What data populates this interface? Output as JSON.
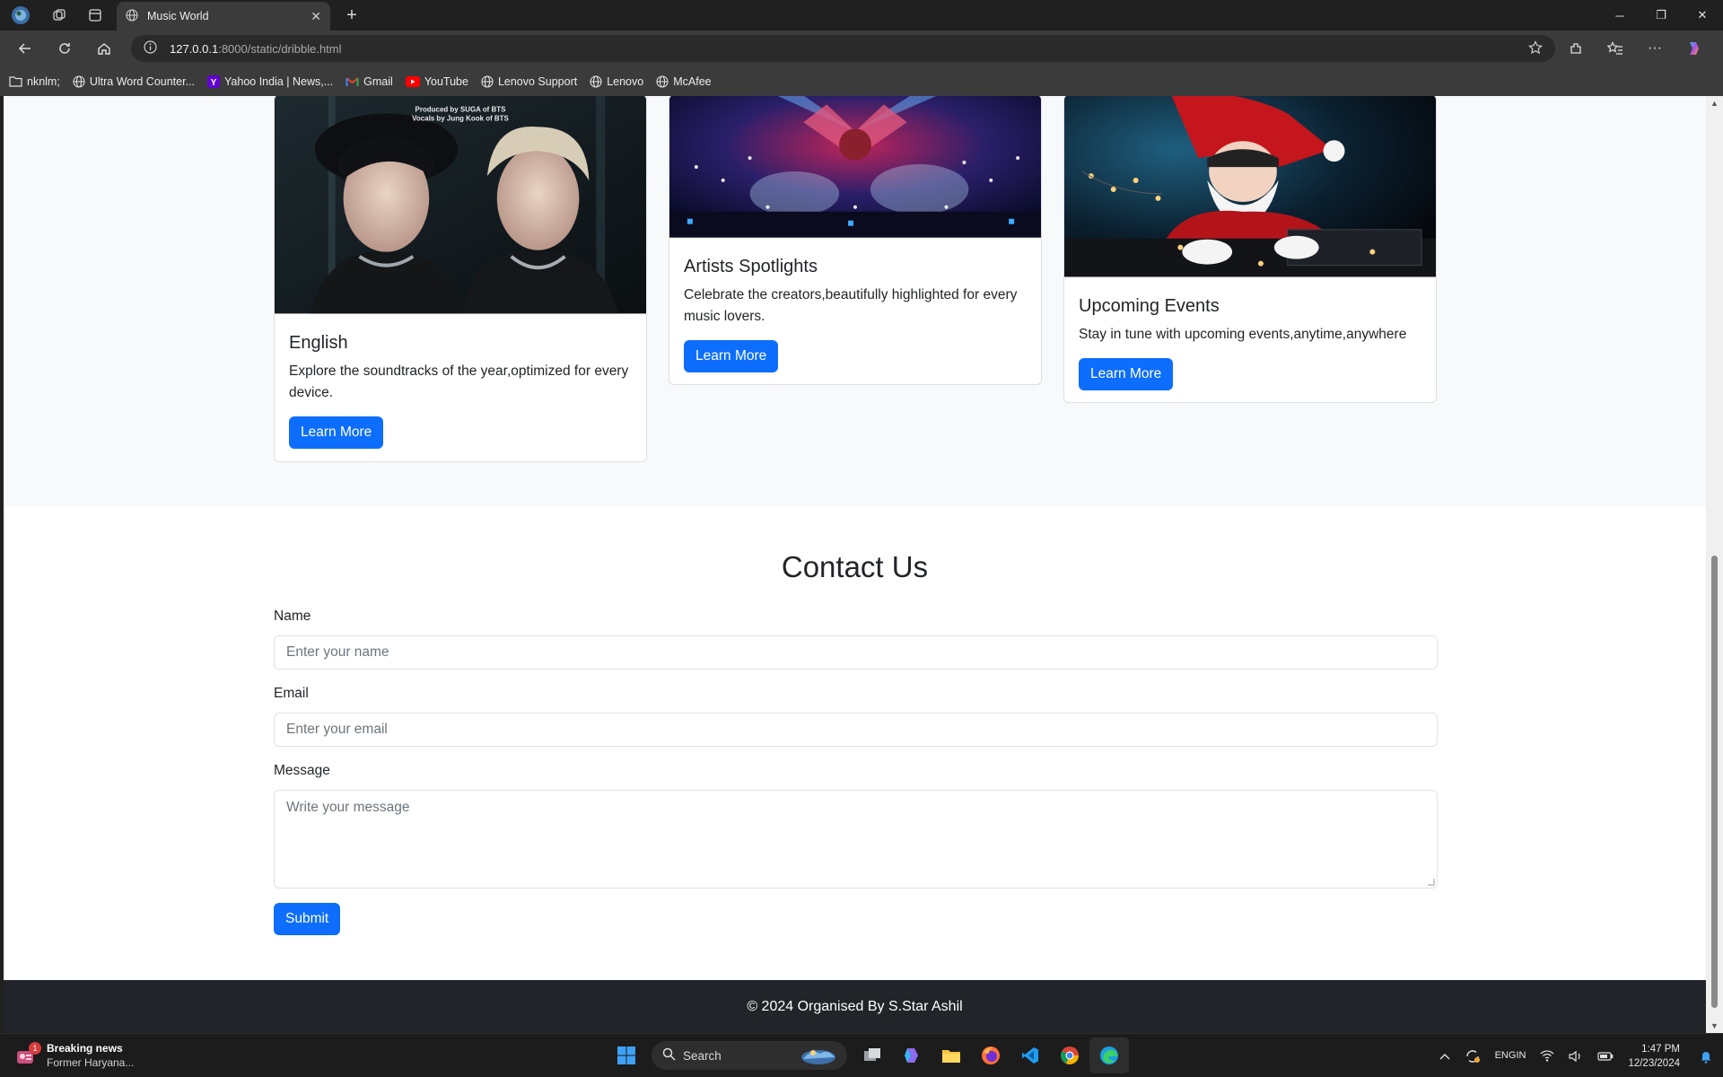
{
  "browser": {
    "tab_title": "Music World",
    "url_host": "127.0.0.1",
    "url_rest": ":8000/static/dribble.html",
    "bookmarks": [
      {
        "label": "nknlm;",
        "icon": "folder-icon"
      },
      {
        "label": "Ultra Word Counter...",
        "icon": "globe-icon"
      },
      {
        "label": "Yahoo India | News,...",
        "icon": "yahoo-icon"
      },
      {
        "label": "Gmail",
        "icon": "gmail-icon"
      },
      {
        "label": "YouTube",
        "icon": "youtube-icon"
      },
      {
        "label": "Lenovo Support",
        "icon": "globe-icon"
      },
      {
        "label": "Lenovo",
        "icon": "globe-icon"
      },
      {
        "label": "McAfee",
        "icon": "globe-icon"
      }
    ]
  },
  "cards": [
    {
      "title": "English",
      "text": "Explore the soundtracks of the year,optimized for every device.",
      "button": "Learn More"
    },
    {
      "title": "Artists Spotlights",
      "text": "Celebrate the creators,beautifully highlighted for every music lovers.",
      "button": "Learn More"
    },
    {
      "title": "Upcoming Events",
      "text": "Stay in tune with upcoming events,anytime,anywhere",
      "button": "Learn More"
    }
  ],
  "card_images": {
    "english": {
      "caption_line1": "Produced by SUGA of BTS",
      "caption_line2": "Vocals by Jung Kook of BTS"
    }
  },
  "contact": {
    "heading": "Contact Us",
    "name_label": "Name",
    "name_placeholder": "Enter your name",
    "email_label": "Email",
    "email_placeholder": "Enter your email",
    "message_label": "Message",
    "message_placeholder": "Write your message",
    "submit_label": "Submit"
  },
  "footer": {
    "text": "© 2024 Organised By S.Star Ashil"
  },
  "taskbar": {
    "news_title": "Breaking news",
    "news_sub": "Former Haryana...",
    "news_badge": "1",
    "search_label": "Search",
    "lang_line1": "ENG",
    "lang_line2": "IN",
    "time": "1:47 PM",
    "date": "12/23/2024"
  },
  "colors": {
    "primary": "#0d6efd",
    "footer_bg": "#212529",
    "section_bg": "#f8f9fa"
  }
}
